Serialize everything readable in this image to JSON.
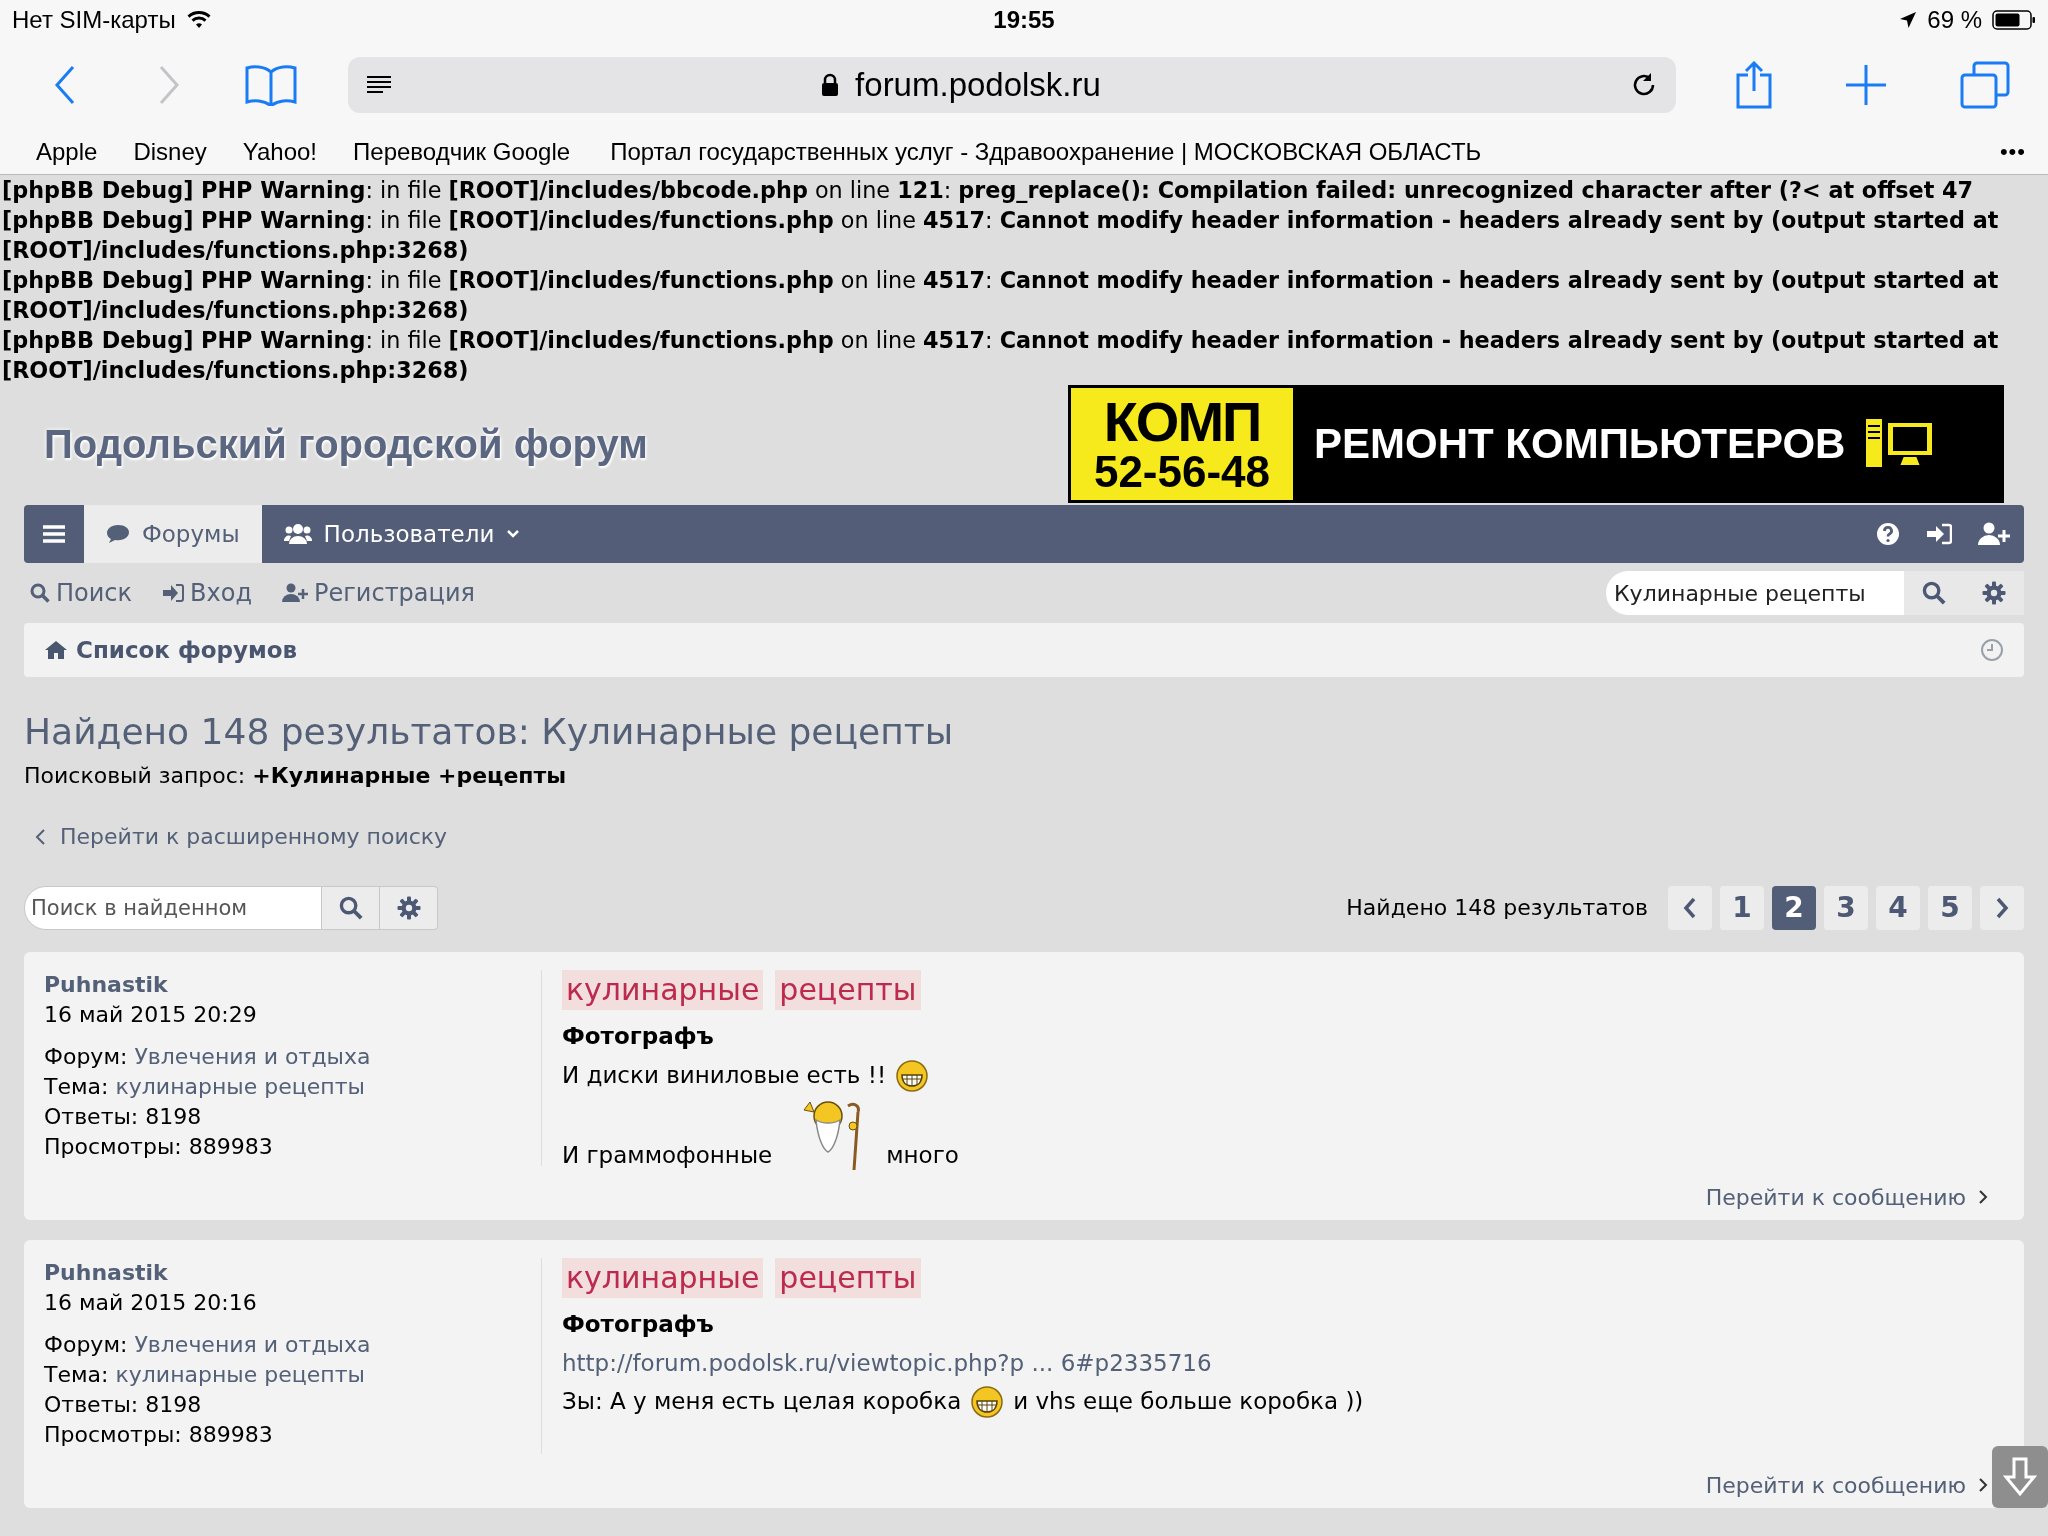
{
  "status_bar": {
    "carrier": "Нет SIM-карты",
    "time": "19:55",
    "battery": "69 %"
  },
  "browser": {
    "url": "forum.podolsk.ru",
    "bookmarks": [
      "Apple",
      "Disney",
      "Yahoo!",
      "Переводчик Google",
      "Портал государственных услуг - Здравоохранение | МОСКОВСКАЯ ОБЛАСТЬ"
    ],
    "more": "•••"
  },
  "debug_messages": [
    "**[phpBB Debug] PHP Warning**: in file **[ROOT]/includes/bbcode.php** on line **121**: **preg_replace(): Compilation failed: unrecognized character after (?< at offset 47**",
    "**[phpBB Debug] PHP Warning**: in file **[ROOT]/includes/functions.php** on line **4517**: **Cannot modify header information - headers already sent by (output started at [ROOT]/includes/functions.php:3268)**",
    "**[phpBB Debug] PHP Warning**: in file **[ROOT]/includes/functions.php** on line **4517**: **Cannot modify header information - headers already sent by (output started at [ROOT]/includes/functions.php:3268)**",
    "**[phpBB Debug] PHP Warning**: in file **[ROOT]/includes/functions.php** on line **4517**: **Cannot modify header information - headers already sent by (output started at [ROOT]/includes/functions.php:3268)**"
  ],
  "forum": {
    "title": "Подольский городской форум",
    "banner": {
      "logo": "КОМП",
      "phone": "52-56-48",
      "slogan": "РЕМОНТ КОМПЬЮТЕРОВ"
    }
  },
  "nav": {
    "tabs": [
      {
        "label": "Форумы",
        "selected": true,
        "kind": "forums"
      },
      {
        "label": "Пользователи",
        "selected": false,
        "kind": "users"
      }
    ]
  },
  "quick_links": [
    {
      "label": "Поиск",
      "kind": "search"
    },
    {
      "label": "Вход",
      "kind": "login"
    },
    {
      "label": "Регистрация",
      "kind": "register"
    }
  ],
  "search": {
    "value": "Кулинарные рецепты"
  },
  "breadcrumb": "Список форумов",
  "results": {
    "heading": "Найдено 148 результатов: Кулинарные рецепты",
    "query": "Поисковый запрос: **+Кулинарные +рецепты**",
    "advanced_link": "Перейти к расширенному поиску",
    "search_placeholder": "Поиск в найденном",
    "count": "Найдено 148 результатов",
    "pages": [
      {
        "label": "1",
        "selected": false
      },
      {
        "label": "2",
        "selected": true
      },
      {
        "label": "3",
        "selected": false
      },
      {
        "label": "4",
        "selected": false
      },
      {
        "label": "5",
        "selected": false
      }
    ]
  },
  "posts": [
    {
      "author": "Puhnastik",
      "date": "16 май 2015 20:29",
      "meta": [
        {
          "label": "Форум:",
          "value": "Увлечения и отдыха",
          "link": true
        },
        {
          "label": "Тема:",
          "value": "кулинарные рецепты",
          "link": true
        },
        {
          "label": "Ответы:",
          "value": "8198",
          "link": false
        },
        {
          "label": "Просмотры:",
          "value": "889983",
          "link": false
        }
      ],
      "title_words": [
        "кулинарные",
        "рецепты"
      ],
      "subject": "Фотографъ",
      "lines": [
        [
          {
            "kind": "text",
            "text": "И диски виниловые есть !!"
          },
          {
            "kind": "grin"
          }
        ],
        [
          {
            "kind": "text",
            "text": "И граммофонные"
          },
          {
            "kind": "figure"
          },
          {
            "kind": "text",
            "text": "много"
          }
        ]
      ],
      "jump": "Перейти к сообщению"
    },
    {
      "author": "Puhnastik",
      "date": "16 май 2015 20:16",
      "meta": [
        {
          "label": "Форум:",
          "value": "Увлечения и отдыха",
          "link": true
        },
        {
          "label": "Тема:",
          "value": "кулинарные рецепты",
          "link": true
        },
        {
          "label": "Ответы:",
          "value": "8198",
          "link": false
        },
        {
          "label": "Просмотры:",
          "value": "889983",
          "link": false
        }
      ],
      "title_words": [
        "кулинарные",
        "рецепты"
      ],
      "subject": "Фотографъ",
      "lines": [
        [
          {
            "kind": "link",
            "text": "http://forum.podolsk.ru/viewtopic.php?p ... 6#p2335716"
          }
        ],
        [
          {
            "kind": "text",
            "text": "Зы: А у меня есть целая коробка"
          },
          {
            "kind": "grin"
          },
          {
            "kind": "text",
            "text": "и vhs еще больше коробка ))"
          }
        ]
      ],
      "jump": "Перейти к сообщению"
    }
  ]
}
